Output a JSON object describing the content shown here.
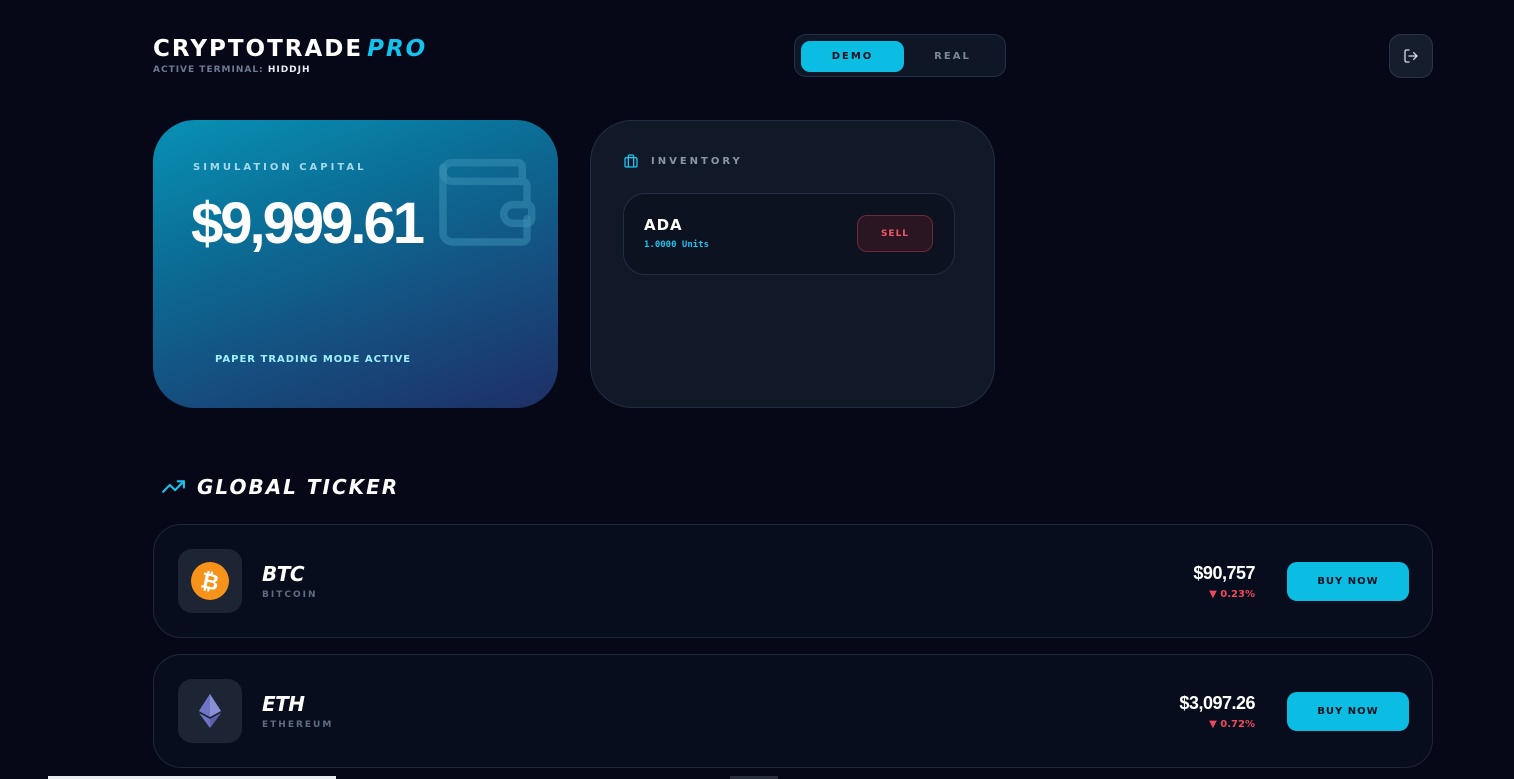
{
  "brand": {
    "title": "CRYPTOTRADE",
    "title_accent": "PRO",
    "terminal_label": "ACTIVE TERMINAL:",
    "terminal_id": "HIDDJH"
  },
  "mode_toggle": {
    "demo_label": "DEMO",
    "real_label": "REAL",
    "selected": "DEMO"
  },
  "logout": {
    "icon": "logout-icon"
  },
  "capital": {
    "label": "SIMULATION CAPITAL",
    "amount": "$9,999.61",
    "status": "PAPER TRADING MODE ACTIVE",
    "icon": "wallet-icon"
  },
  "inventory": {
    "label": "INVENTORY",
    "icon": "briefcase-icon",
    "items": [
      {
        "symbol": "ADA",
        "units": "1.0000 Units",
        "sell_label": "SELL"
      }
    ]
  },
  "ticker": {
    "title": "GLOBAL TICKER",
    "icon": "trending-up-icon",
    "rows": [
      {
        "symbol": "BTC",
        "name": "BITCOIN",
        "price": "$90,757",
        "change": "▼ 0.23%",
        "buy_label": "BUY NOW",
        "icon": "bitcoin-icon"
      },
      {
        "symbol": "ETH",
        "name": "ETHEREUM",
        "price": "$3,097.26",
        "change": "▼ 0.72%",
        "buy_label": "BUY NOW",
        "icon": "ethereum-icon"
      }
    ]
  },
  "colors": {
    "accent": "#0cbde3",
    "background": "#060818",
    "negative": "#ef4a5c",
    "bitcoin": "#f7931a"
  }
}
